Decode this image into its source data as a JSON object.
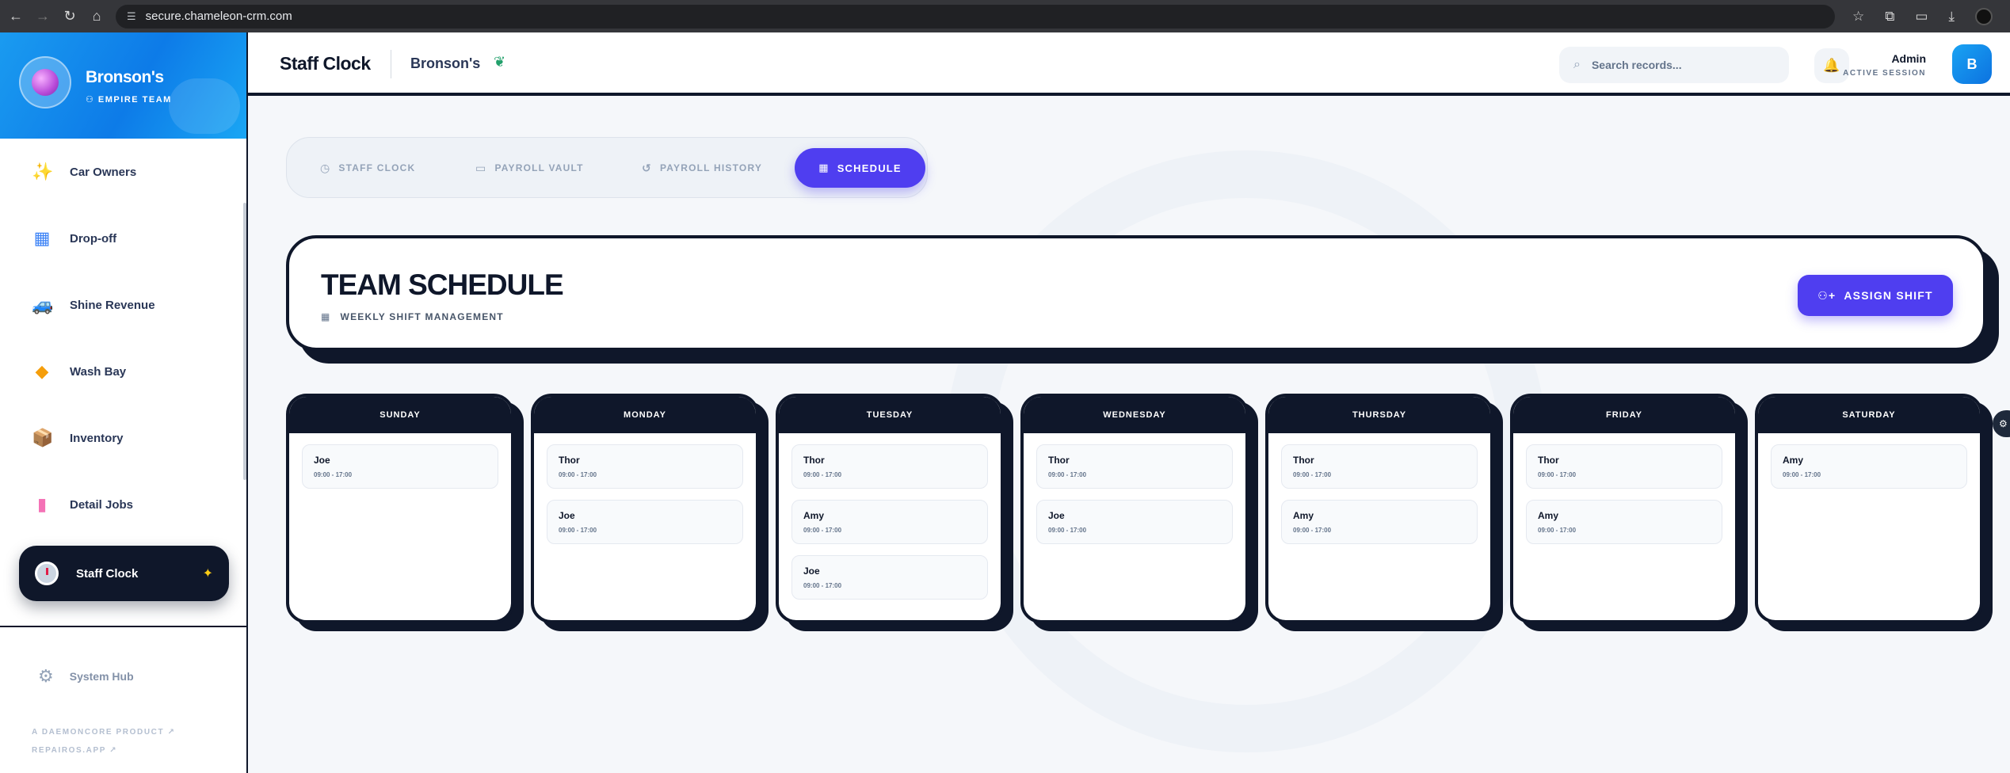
{
  "browser": {
    "url": "secure.chameleon-crm.com"
  },
  "sidebar": {
    "brand_name": "Bronson's",
    "brand_sub": "EMPIRE TEAM",
    "items": [
      {
        "label": "Car Owners",
        "icon": "sparkles-icon"
      },
      {
        "label": "Drop-off",
        "icon": "calendar-icon"
      },
      {
        "label": "Shine Revenue",
        "icon": "car-icon"
      },
      {
        "label": "Wash Bay",
        "icon": "sponge-icon"
      },
      {
        "label": "Inventory",
        "icon": "box-icon"
      },
      {
        "label": "Detail Jobs",
        "icon": "spray-bottle-icon"
      }
    ],
    "active_item": "Staff Clock",
    "system_hub": "System Hub",
    "footer_product": "A DAEMONCORE PRODUCT",
    "footer_link": "REPAIROS.APP"
  },
  "header": {
    "title": "Staff Clock",
    "shop": "Bronson's",
    "search_placeholder": "Search records...",
    "user_name": "Admin",
    "user_role": "ACTIVE SESSION",
    "avatar_initial": "B"
  },
  "tabs": [
    {
      "label": "STAFF CLOCK",
      "icon": "clock-icon"
    },
    {
      "label": "PAYROLL VAULT",
      "icon": "wallet-icon"
    },
    {
      "label": "PAYROLL HISTORY",
      "icon": "history-icon"
    },
    {
      "label": "SCHEDULE",
      "icon": "calendar-icon",
      "active": true
    }
  ],
  "schedule": {
    "title": "TEAM SCHEDULE",
    "subtitle": "WEEKLY SHIFT MANAGEMENT",
    "assign_label": "ASSIGN SHIFT",
    "days": [
      {
        "name": "SUNDAY",
        "shifts": [
          {
            "name": "Joe",
            "time": "09:00 - 17:00"
          }
        ]
      },
      {
        "name": "MONDAY",
        "shifts": [
          {
            "name": "Thor",
            "time": "09:00 - 17:00"
          },
          {
            "name": "Joe",
            "time": "09:00 - 17:00"
          }
        ]
      },
      {
        "name": "TUESDAY",
        "shifts": [
          {
            "name": "Thor",
            "time": "09:00 - 17:00"
          },
          {
            "name": "Amy",
            "time": "09:00 - 17:00"
          },
          {
            "name": "Joe",
            "time": "09:00 - 17:00"
          }
        ]
      },
      {
        "name": "WEDNESDAY",
        "shifts": [
          {
            "name": "Thor",
            "time": "09:00 - 17:00"
          },
          {
            "name": "Joe",
            "time": "09:00 - 17:00"
          }
        ]
      },
      {
        "name": "THURSDAY",
        "shifts": [
          {
            "name": "Thor",
            "time": "09:00 - 17:00"
          },
          {
            "name": "Amy",
            "time": "09:00 - 17:00"
          }
        ]
      },
      {
        "name": "FRIDAY",
        "shifts": [
          {
            "name": "Thor",
            "time": "09:00 - 17:00"
          },
          {
            "name": "Amy",
            "time": "09:00 - 17:00"
          }
        ]
      },
      {
        "name": "SATURDAY",
        "shifts": [
          {
            "name": "Amy",
            "time": "09:00 - 17:00"
          }
        ]
      }
    ]
  },
  "colors": {
    "accent": "#4f3ef0",
    "navy": "#0f172a",
    "brand_blue": "#0d7be8"
  }
}
